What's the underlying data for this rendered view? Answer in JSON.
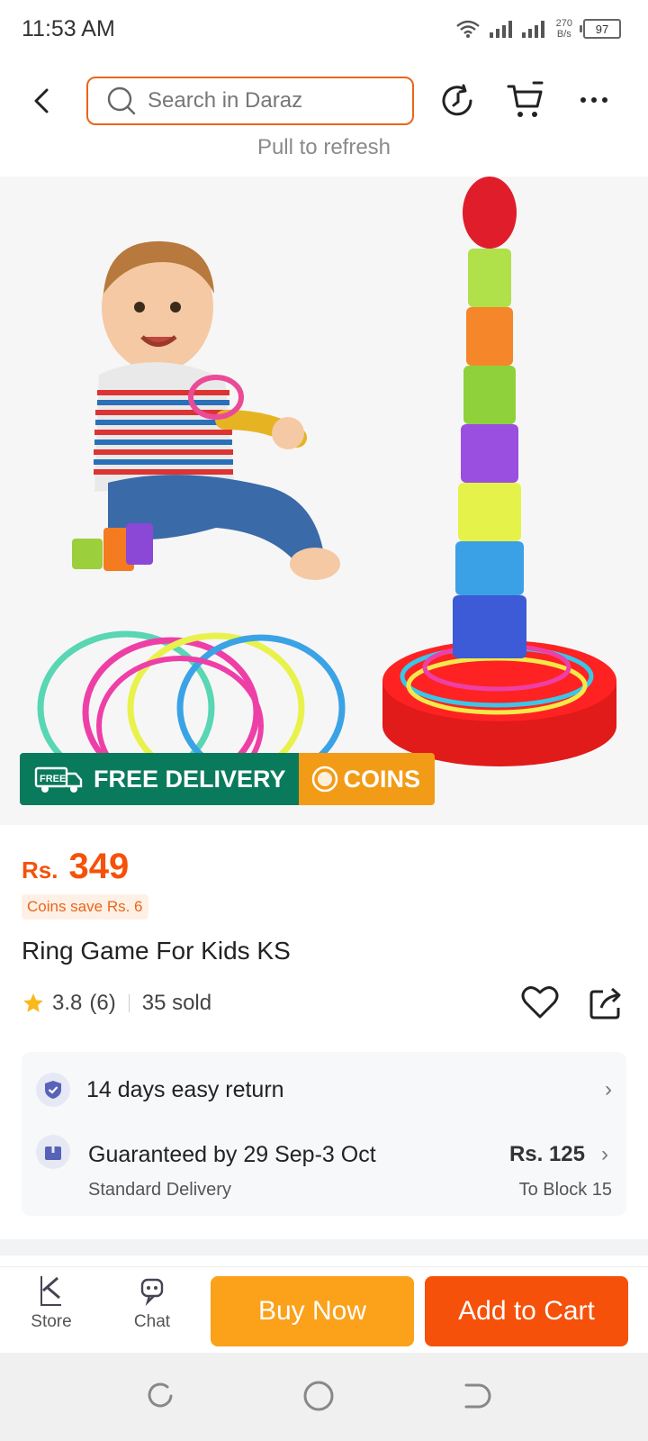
{
  "status_bar": {
    "time": "11:53 AM",
    "net_speed_value": "270",
    "net_speed_unit": "B/s",
    "battery": "97"
  },
  "header": {
    "search_placeholder": "Search in Daraz",
    "pull_to_refresh": "Pull to refresh"
  },
  "badge": {
    "free_delivery": "FREE DELIVERY",
    "free_tag": "FREE",
    "coins": "COINS"
  },
  "product": {
    "currency": "Rs.",
    "price": "349",
    "coins_save": "Coins save Rs. 6",
    "title": "Ring Game For Kids KS",
    "rating": "3.8",
    "rating_count": "(6)",
    "sold": "35 sold"
  },
  "services": {
    "return_text": "14 days easy return",
    "delivery_title": "Guaranteed by 29 Sep-3 Oct",
    "delivery_type": "Standard Delivery",
    "delivery_fee": "Rs. 125",
    "delivery_to": "To Block 15"
  },
  "bottom_bar": {
    "store_label": "Store",
    "chat_label": "Chat",
    "buy_now": "Buy Now",
    "add_to_cart": "Add to Cart"
  },
  "colors": {
    "accent": "#f5510a",
    "buy_now": "#fba11a",
    "free_delivery": "#0a7a5c",
    "coins": "#f29b17",
    "search_border": "#e9661a"
  }
}
